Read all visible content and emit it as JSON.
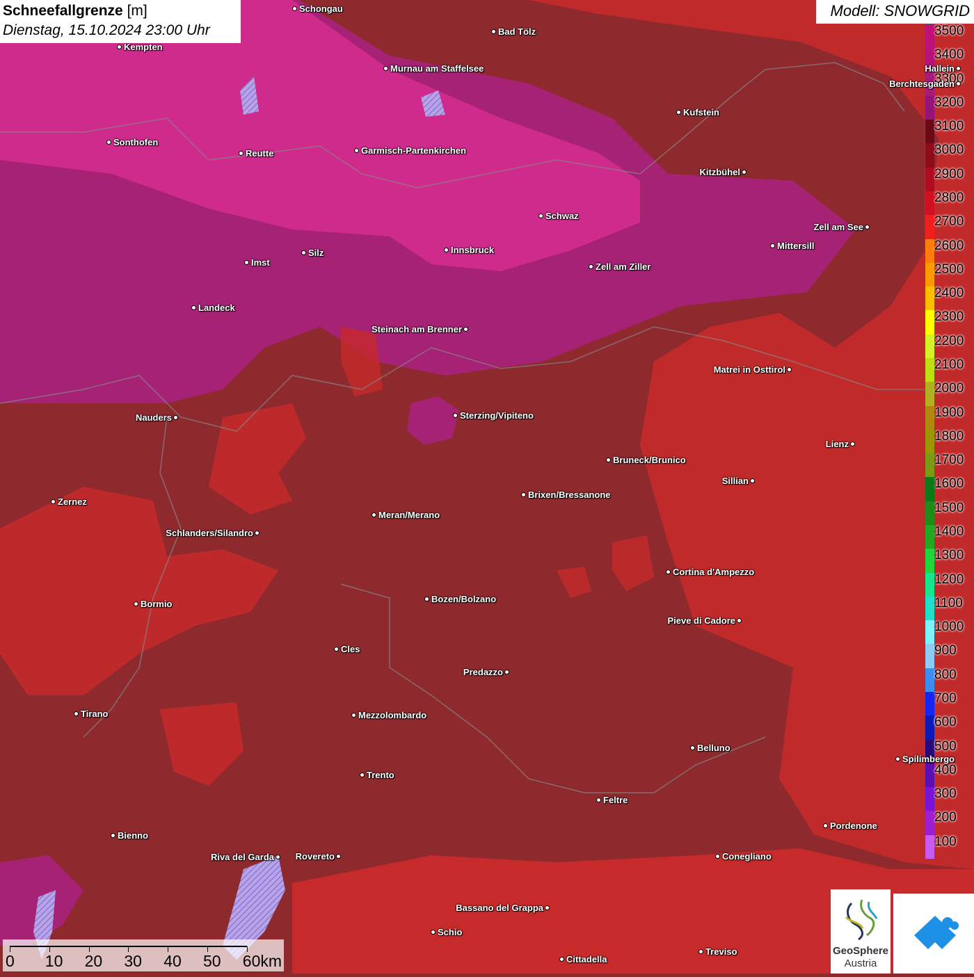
{
  "header": {
    "title_bold": "Schneefallgrenze",
    "title_unit": "[m]",
    "datetime": "Dienstag, 15.10.2024 23:00 Uhr"
  },
  "model": {
    "label": "Modell: SNOWGRID"
  },
  "legend": {
    "labels": [
      "3500",
      "3400",
      "3300",
      "3200",
      "3100",
      "3000",
      "2900",
      "2800",
      "2700",
      "2600",
      "2500",
      "2400",
      "2300",
      "2200",
      "2100",
      "2000",
      "1900",
      "1800",
      "1700",
      "1600",
      "1500",
      "1400",
      "1300",
      "1200",
      "1100",
      "1000",
      "900",
      "800",
      "700",
      "600",
      "500",
      "400",
      "300",
      "200",
      "100"
    ],
    "colors": [
      "#c0117a",
      "#b8137a",
      "#a81a7c",
      "#95137a",
      "#6b0a17",
      "#8f0c1b",
      "#b00c1f",
      "#d10f22",
      "#f01e1e",
      "#ff7d0d",
      "#ff9a00",
      "#ffbf00",
      "#ffff00",
      "#d5f025",
      "#bede14",
      "#b3b01f",
      "#b08810",
      "#9b9700",
      "#7a9c14",
      "#0d7a1a",
      "#1f8c1a",
      "#22a822",
      "#1fd63c",
      "#14e68c",
      "#1fe0c8",
      "#7df2ff",
      "#8ecaf5",
      "#3a8ef0",
      "#1426f0",
      "#0d1ab4",
      "#2a0a7a",
      "#5a0eb4",
      "#7a14d6",
      "#a01ed2",
      "#c85af0"
    ]
  },
  "places": [
    {
      "name": "Schongau"
    },
    {
      "name": "Bad Tölz"
    },
    {
      "name": "Kempten"
    },
    {
      "name": "Murnau am Staffelsee"
    },
    {
      "name": "Berchtesgaden"
    },
    {
      "name": "Hallein"
    },
    {
      "name": "Kufstein"
    },
    {
      "name": "Sonthofen"
    },
    {
      "name": "Reutte"
    },
    {
      "name": "Garmisch-Partenkirchen"
    },
    {
      "name": "Kitzbühel"
    },
    {
      "name": "Schwaz"
    },
    {
      "name": "Zell am See"
    },
    {
      "name": "Mittersill"
    },
    {
      "name": "Innsbruck"
    },
    {
      "name": "Silz"
    },
    {
      "name": "Imst"
    },
    {
      "name": "Zell am Ziller"
    },
    {
      "name": "Landeck"
    },
    {
      "name": "Steinach am Brenner"
    },
    {
      "name": "Matrei in Osttirol"
    },
    {
      "name": "Nauders"
    },
    {
      "name": "Sterzing/Vipiteno"
    },
    {
      "name": "Lienz"
    },
    {
      "name": "Bruneck/Brunico"
    },
    {
      "name": "Sillian"
    },
    {
      "name": "Zernez"
    },
    {
      "name": "Brixen/Bressanone"
    },
    {
      "name": "Meran/Merano"
    },
    {
      "name": "Schlanders/Silandro"
    },
    {
      "name": "Cortina d'Ampezzo"
    },
    {
      "name": "Bozen/Bolzano"
    },
    {
      "name": "Bormio"
    },
    {
      "name": "Pieve di Cadore"
    },
    {
      "name": "Cles"
    },
    {
      "name": "Predazzo"
    },
    {
      "name": "Tirano"
    },
    {
      "name": "Mezzolombardo"
    },
    {
      "name": "Belluno"
    },
    {
      "name": "Spilimbergo"
    },
    {
      "name": "Trento"
    },
    {
      "name": "Feltre"
    },
    {
      "name": "Pordenone"
    },
    {
      "name": "Bienno"
    },
    {
      "name": "Riva del Garda"
    },
    {
      "name": "Rovereto"
    },
    {
      "name": "Conegliano"
    },
    {
      "name": "Bassano del Grappa"
    },
    {
      "name": "Schio"
    },
    {
      "name": "Treviso"
    },
    {
      "name": "Cittadella"
    }
  ],
  "scale": {
    "labels": [
      "0",
      "10",
      "20",
      "30",
      "40",
      "50",
      "60km"
    ]
  },
  "logos": {
    "geosphere_name": "GeoSphere",
    "geosphere_sub": "Austria"
  }
}
